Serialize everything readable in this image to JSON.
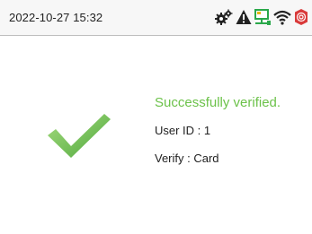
{
  "status_bar": {
    "datetime": "2022-10-27 15:32",
    "icons": [
      "settings-gear-icon",
      "warning-icon",
      "network-computer-icon",
      "wifi-icon",
      "alarm-icon"
    ]
  },
  "verification": {
    "title": "Successfully verified.",
    "user_id": "User ID : 1",
    "verify_mode": "Verify : Card"
  },
  "colors": {
    "success": "#6cc24a",
    "alarm": "#d93b3b",
    "network": "#2aa84a"
  }
}
